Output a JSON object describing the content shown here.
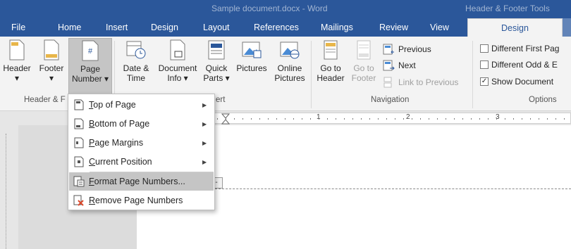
{
  "window": {
    "title": "Sample document.docx - Word",
    "context_title": "Header & Footer Tools"
  },
  "tabs": [
    {
      "label": "File"
    },
    {
      "label": "Home"
    },
    {
      "label": "Insert"
    },
    {
      "label": "Design"
    },
    {
      "label": "Layout"
    },
    {
      "label": "References"
    },
    {
      "label": "Mailings"
    },
    {
      "label": "Review"
    },
    {
      "label": "View"
    },
    {
      "label": "Design"
    }
  ],
  "ribbon": {
    "header": {
      "label": "Header",
      "caret": "▾"
    },
    "footer": {
      "label": "Footer",
      "caret": "▾"
    },
    "page_number": {
      "line1": "Page",
      "line2": "Number ▾"
    },
    "group_hf_label": "Header & F",
    "date_time": {
      "line1": "Date &",
      "line2": "Time"
    },
    "doc_info": {
      "line1": "Document",
      "line2": "Info ▾"
    },
    "quick_parts": {
      "line1": "Quick",
      "line2": "Parts ▾"
    },
    "pictures": {
      "label": "Pictures"
    },
    "online_pictures": {
      "line1": "Online",
      "line2": "Pictures"
    },
    "group_insert_label": "ert",
    "go_to_header": {
      "line1": "Go to",
      "line2": "Header"
    },
    "go_to_footer": {
      "line1": "Go to",
      "line2": "Footer"
    },
    "previous": {
      "label": "Previous"
    },
    "next": {
      "label": "Next"
    },
    "link_to_previous": {
      "label": "Link to Previous"
    },
    "group_nav_label": "Navigation",
    "options": {
      "different_first": {
        "label": "Different First Pag",
        "checked": false
      },
      "different_odd_even": {
        "label": "Different Odd & E",
        "checked": false
      },
      "show_document": {
        "label": "Show Document",
        "checked": true,
        "mark": "✓"
      }
    },
    "group_options_label": "Options"
  },
  "ruler": {
    "numbers": [
      "1",
      "2",
      "3"
    ]
  },
  "header_tag": "-",
  "menu": {
    "items": [
      {
        "prefix": "",
        "underlined": "T",
        "rest": "op of Page",
        "submenu": true
      },
      {
        "prefix": "",
        "underlined": "B",
        "rest": "ottom of Page",
        "submenu": true
      },
      {
        "prefix": "",
        "underlined": "P",
        "rest": "age Margins",
        "submenu": true
      },
      {
        "prefix": "",
        "underlined": "C",
        "rest": "urrent Position",
        "submenu": true
      },
      {
        "prefix": "",
        "underlined": "F",
        "rest": "ormat Page Numbers...",
        "submenu": false,
        "highlighted": true
      },
      {
        "prefix": "",
        "underlined": "R",
        "rest": "emove Page Numbers",
        "submenu": false
      }
    ],
    "submenu_arrow": "▶"
  },
  "colors": {
    "accent": "#2b579a",
    "ribbon_bg": "#f3f3f3",
    "highlight": "#c5c5c5",
    "remove_icon": "#d9482b"
  }
}
